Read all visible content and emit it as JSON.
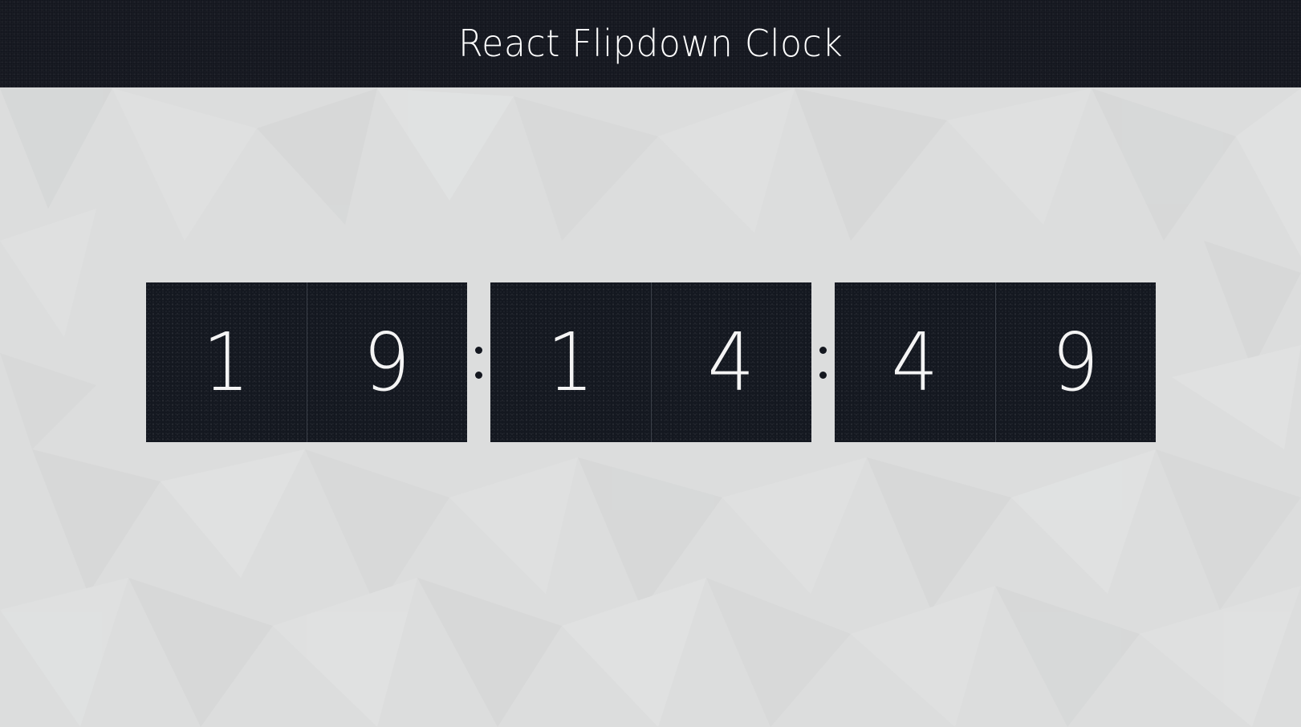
{
  "header": {
    "title": "React Flipdown Clock"
  },
  "clock": {
    "hours": [
      "1",
      "9"
    ],
    "minutes": [
      "1",
      "4"
    ],
    "seconds": [
      "4",
      "9"
    ]
  },
  "colors": {
    "header_bg": "#14171f",
    "card_bg": "#141820",
    "page_bg": "#dcdddd",
    "digit": "#f4f4f4"
  }
}
